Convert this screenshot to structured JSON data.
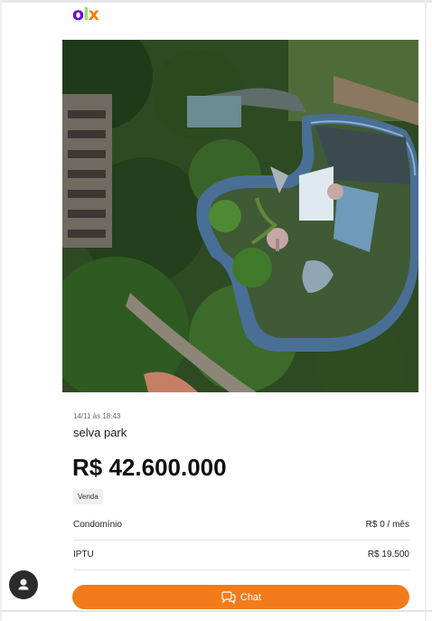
{
  "logo": {
    "o": "o",
    "l": "l",
    "x": "x"
  },
  "ad": {
    "photo": {
      "icon": "aerial-abandoned-waterpark-photo"
    },
    "date": "14/11 às 18:43",
    "title": "selva park",
    "price": "R$ 42.600.000",
    "type_badge": "Venda",
    "details": [
      {
        "label": "Condomínio",
        "value": "R$ 0 / mês"
      },
      {
        "label": "IPTU",
        "value": "R$ 19.500"
      }
    ]
  },
  "actions": {
    "chat_label": "Chat",
    "chat_icon": "chat-bubbles-icon",
    "avatar_icon": "user-icon"
  },
  "colors": {
    "accent": "#f27c1c",
    "brand_purple": "#6e0ad6",
    "brand_green": "#8ce563",
    "brand_orange": "#f28000"
  }
}
